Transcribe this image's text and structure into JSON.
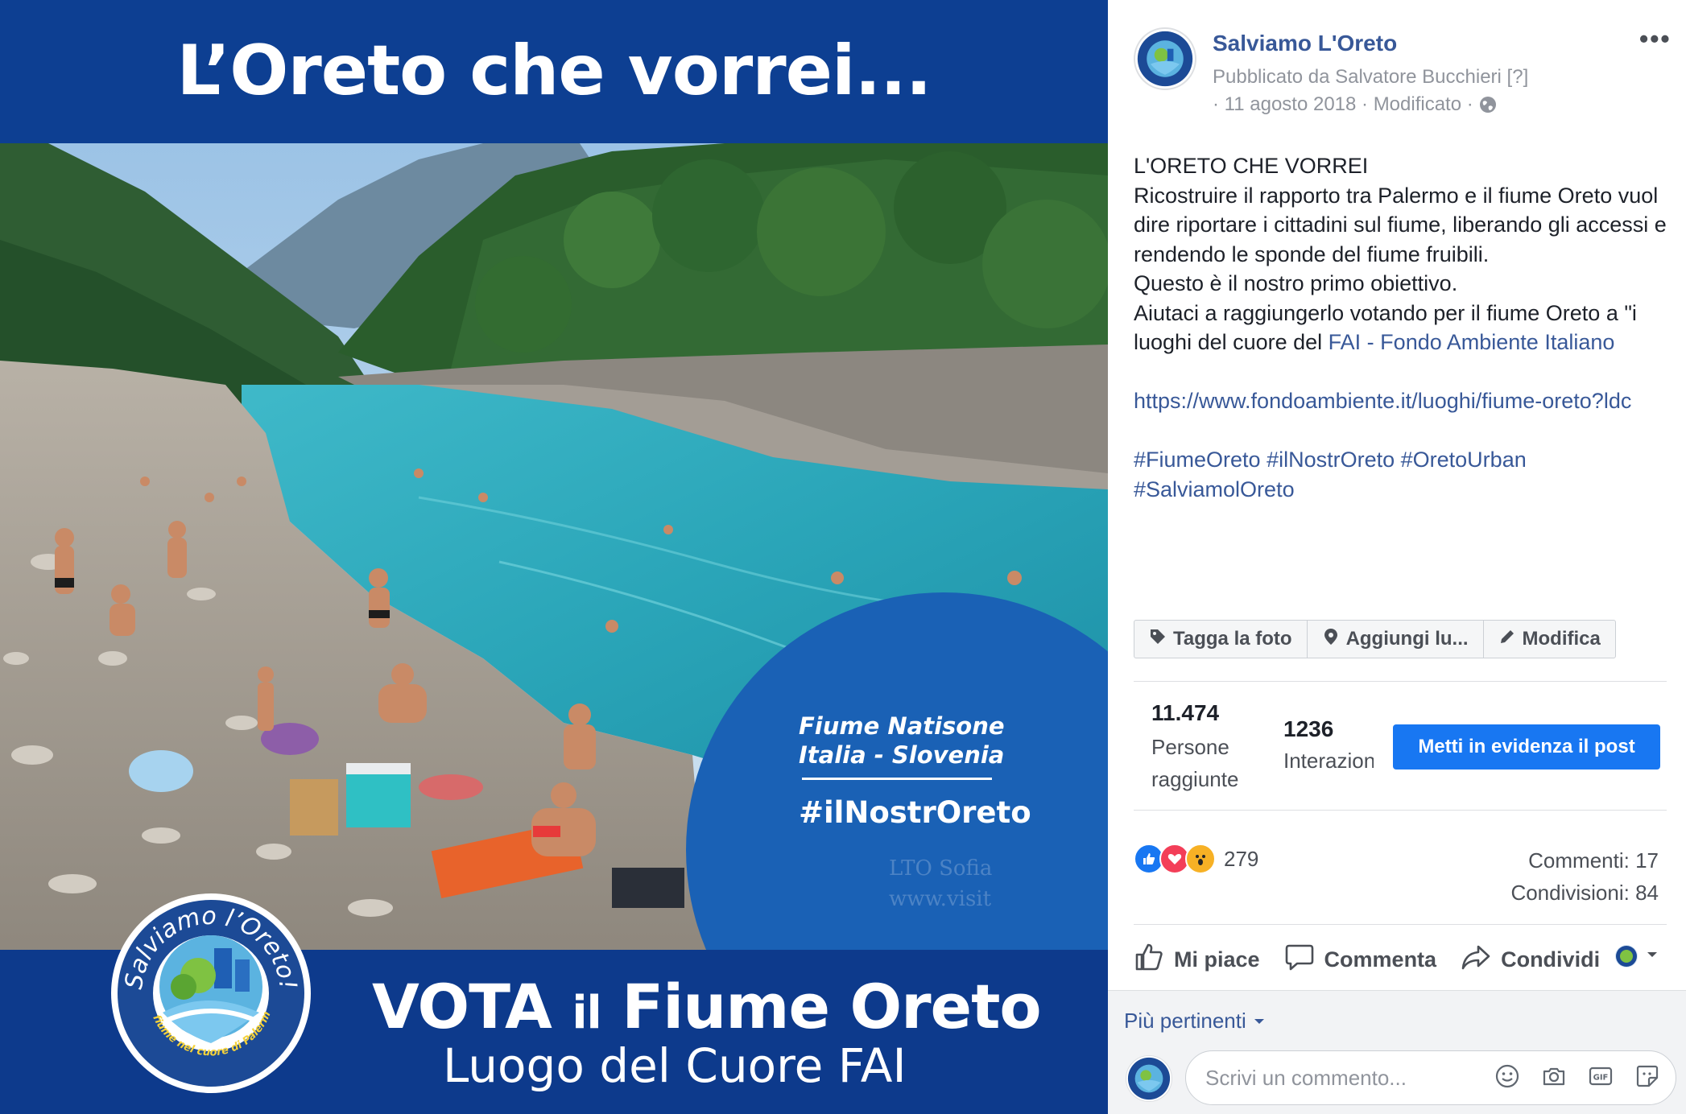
{
  "poster": {
    "title": "L’Oreto che vorrei...",
    "badge_line1": "Fiume Natisone",
    "badge_line2": "Italia - Slovenia",
    "badge_hashtag": "#ilNostrOreto",
    "watermark_line1": "LTO Sofia",
    "watermark_line2": "www.visit",
    "vote_big": "VOTA",
    "vote_small": "il",
    "vote_rest": "Fiume Oreto",
    "vote_line2": "Luogo del Cuore FAI",
    "seal_top_text": "Salviamo l’Oreto!",
    "seal_bottom_text": "Il fiume nel cuore di Palermo"
  },
  "post": {
    "page_name": "Salviamo L'Oreto",
    "published_by": "Pubblicato da Salvatore Bucchieri",
    "published_marker": "[?]",
    "meta_line": "· 11 agosto 2018 · Modificato ·",
    "more_label": "•••",
    "body": {
      "line1": "L'ORETO CHE VORREI",
      "line2": "Ricostruire il rapporto tra Palermo e il fiume Oreto vuol dire riportare i cittadini sul fiume, liberando gli accessi e rendendo le sponde del fiume fruibili.",
      "line3": "Questo è il nostro primo obiettivo.",
      "line4_prefix": "Aiutaci a raggiungerlo votando per il fiume Oreto a \"i luoghi del cuore del ",
      "line4_link": "FAI - Fondo Ambiente Italiano",
      "url": "https://www.fondoambiente.it/luoghi/fiume-oreto?ldc",
      "hashtag1": "#FiumeOreto",
      "hashtag2": "#ilNostrOreto",
      "hashtag3": "#OretoUrban",
      "hashtag4": "#SalviamolOreto"
    },
    "photo_actions": {
      "tag": "Tagga la foto",
      "location": "Aggiungi lu...",
      "edit": "Modifica"
    },
    "stats": {
      "reach_value": "11.474",
      "reach_label": "Persone raggiunte",
      "interactions_value": "1236",
      "interactions_label": "Interazioni",
      "boost_label": "Metti in evidenza il post"
    },
    "reactions": {
      "count": "279",
      "comments": "Commenti: 17",
      "shares": "Condivisioni: 84"
    },
    "actions": {
      "like": "Mi piace",
      "comment": "Commenta",
      "share": "Condividi"
    },
    "comments": {
      "sort_label": "Più pertinenti",
      "placeholder": "Scrivi un commento..."
    }
  },
  "colors": {
    "poster_blue": "#0d3a8c",
    "badge_blue": "#1a61b5",
    "link_blue": "#385898",
    "button_blue": "#1877f2"
  }
}
